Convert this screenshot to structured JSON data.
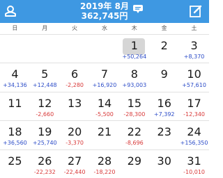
{
  "header": {
    "month": "2019年 8月",
    "total": "362,745円",
    "left_icon": "user-icon",
    "right_icon": "edit-icon",
    "center_icon": "chat-icon"
  },
  "weekdays": [
    "日",
    "月",
    "火",
    "水",
    "木",
    "金",
    "土"
  ],
  "weeks": [
    [
      {
        "day": "",
        "amount": ""
      },
      {
        "day": "",
        "amount": ""
      },
      {
        "day": "",
        "amount": ""
      },
      {
        "day": "",
        "amount": ""
      },
      {
        "day": "1",
        "amount": "+50,264",
        "sign": "pos",
        "today": true
      },
      {
        "day": "2",
        "amount": ""
      },
      {
        "day": "3",
        "amount": "+8,370",
        "sign": "pos"
      }
    ],
    [
      {
        "day": "4",
        "amount": "+34,136",
        "sign": "pos"
      },
      {
        "day": "5",
        "amount": "+12,448",
        "sign": "pos"
      },
      {
        "day": "6",
        "amount": "-2,280",
        "sign": "neg"
      },
      {
        "day": "7",
        "amount": "+16,920",
        "sign": "pos"
      },
      {
        "day": "8",
        "amount": "+93,003",
        "sign": "pos"
      },
      {
        "day": "9",
        "amount": ""
      },
      {
        "day": "10",
        "amount": "+57,610",
        "sign": "pos"
      }
    ],
    [
      {
        "day": "11",
        "amount": ""
      },
      {
        "day": "12",
        "amount": "-2,660",
        "sign": "neg"
      },
      {
        "day": "13",
        "amount": ""
      },
      {
        "day": "14",
        "amount": "-5,500",
        "sign": "neg"
      },
      {
        "day": "15",
        "amount": "-28,300",
        "sign": "neg"
      },
      {
        "day": "16",
        "amount": "+7,392",
        "sign": "pos"
      },
      {
        "day": "17",
        "amount": "-12,340",
        "sign": "neg"
      }
    ],
    [
      {
        "day": "18",
        "amount": "+36,560",
        "sign": "pos"
      },
      {
        "day": "19",
        "amount": "+25,740",
        "sign": "pos"
      },
      {
        "day": "20",
        "amount": "-3,370",
        "sign": "neg"
      },
      {
        "day": "21",
        "amount": ""
      },
      {
        "day": "22",
        "amount": "-8,696",
        "sign": "neg"
      },
      {
        "day": "23",
        "amount": ""
      },
      {
        "day": "24",
        "amount": "+156,350",
        "sign": "pos"
      }
    ],
    [
      {
        "day": "25",
        "amount": ""
      },
      {
        "day": "26",
        "amount": "-22,232",
        "sign": "neg"
      },
      {
        "day": "27",
        "amount": "-22,440",
        "sign": "neg"
      },
      {
        "day": "28",
        "amount": "-18,220",
        "sign": "neg"
      },
      {
        "day": "29",
        "amount": ""
      },
      {
        "day": "30",
        "amount": ""
      },
      {
        "day": "31",
        "amount": "-10,010",
        "sign": "neg"
      }
    ]
  ],
  "colors": {
    "header": "#3e98e2",
    "positive": "#2c4cc8",
    "negative": "#d83838",
    "today_highlight": "#d6d6d6"
  }
}
